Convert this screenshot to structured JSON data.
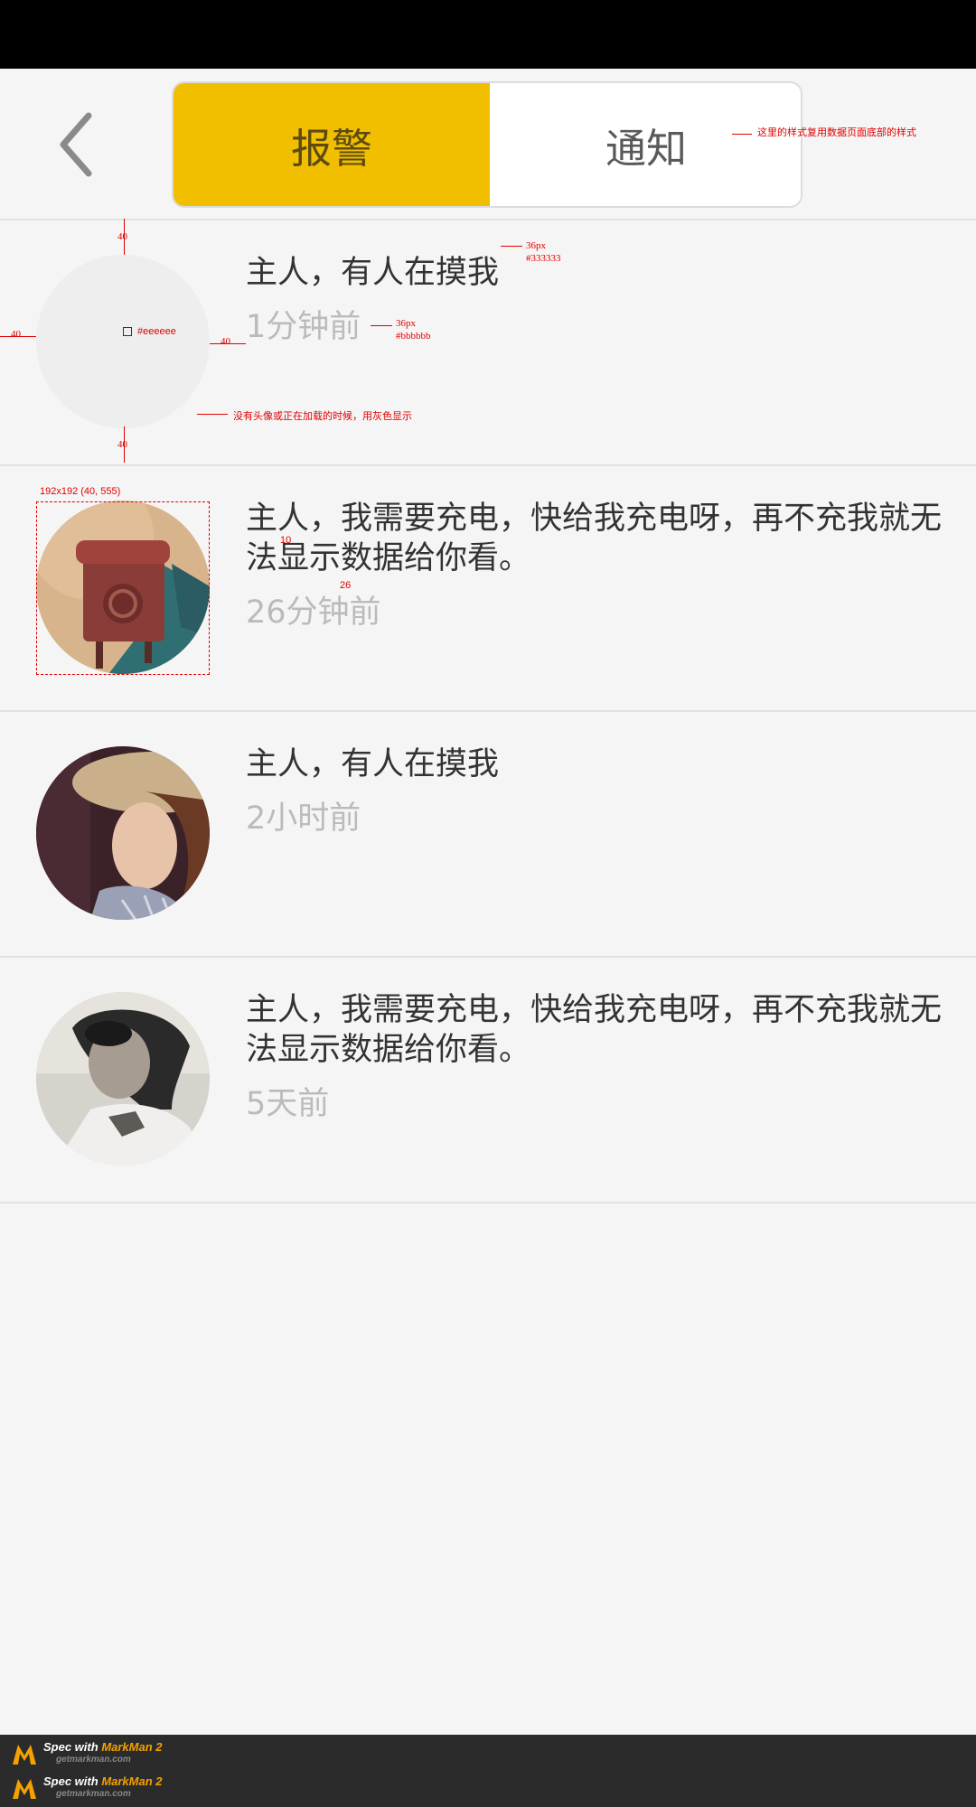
{
  "header": {
    "tabs": [
      {
        "label": "报警",
        "active": true
      },
      {
        "label": "通知",
        "active": false
      }
    ],
    "accent_color": "#f1be00"
  },
  "messages": [
    {
      "title": "主人，有人在摸我",
      "time": "1分钟前",
      "avatar": "placeholder"
    },
    {
      "title": "主人，我需要充电，快给我充电呀，再不充我就无法显示数据给你看。",
      "time": "26分钟前",
      "avatar": "mailbox-photo"
    },
    {
      "title": "主人，有人在摸我",
      "time": "2小时前",
      "avatar": "woman-straw-hat-photo"
    },
    {
      "title": "主人，我需要充电，快给我充电呀，再不充我就无法显示数据给你看。",
      "time": "5天前",
      "avatar": "man-aviator-goggles-photo"
    }
  ],
  "annotations": {
    "tab_note": "这里的样式复用数据页面底部的样式",
    "title_size": "36px",
    "title_color": "#333333",
    "time_size": "36px",
    "time_color": "#bbbbbb",
    "placeholder_color": "#eeeeee",
    "placeholder_note": "没有头像或正在加载的时候，用灰色显示",
    "margin_top": "40",
    "margin_bottom": "40",
    "margin_left": "40",
    "margin_right": "40",
    "avatar_spec": "192x192 (40, 555)",
    "gap_title": "10",
    "gap_time": "26"
  },
  "footer": {
    "brand_prefix": "Spec with",
    "brand_name": "MarkMan 2",
    "url": "getmarkman.com"
  }
}
